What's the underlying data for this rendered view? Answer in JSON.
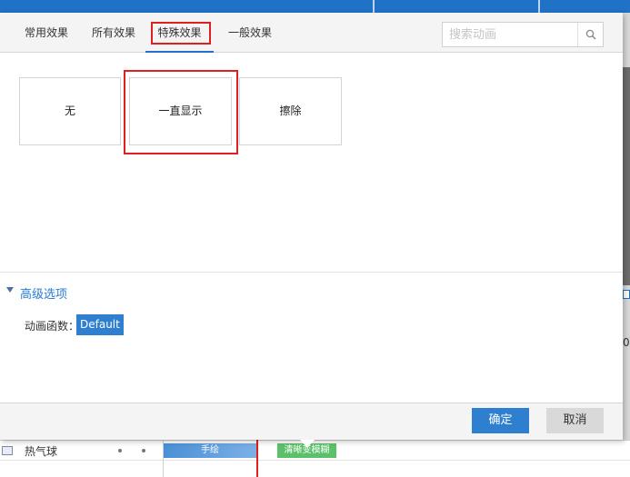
{
  "dialog": {
    "tabs": [
      {
        "label": "常用效果"
      },
      {
        "label": "所有效果"
      },
      {
        "label": "特殊效果"
      },
      {
        "label": "一般效果"
      }
    ],
    "active_tab": "特殊效果",
    "search": {
      "placeholder": "搜索动画",
      "value": ""
    },
    "effects": [
      {
        "label": "无"
      },
      {
        "label": "一直显示"
      },
      {
        "label": "擦除"
      }
    ],
    "advanced": {
      "title": "高级选项",
      "function_label": "动画函数：",
      "function_value": "Default"
    },
    "buttons": {
      "ok": "确定",
      "cancel": "取消"
    }
  },
  "background": {
    "layer_name": "热气球",
    "clip_blue_label": "手绘",
    "clip_green_label": "清晰变模糊",
    "right_number": "0"
  },
  "colors": {
    "accent": "#2f7fd0",
    "highlight": "#e02020",
    "clip_green": "#5bc06a"
  }
}
